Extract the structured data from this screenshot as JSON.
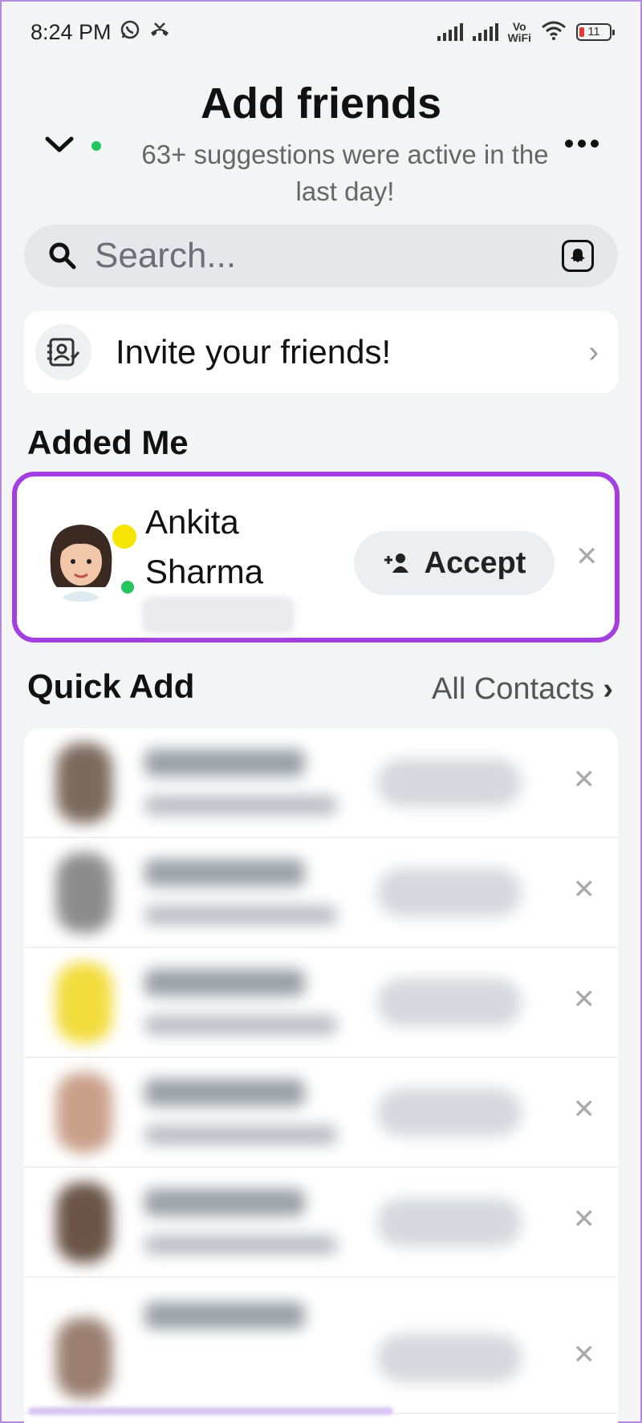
{
  "status_bar": {
    "time": "8:24 PM",
    "vowifi_top": "Vo",
    "vowifi_bottom": "WiFi",
    "battery": "11"
  },
  "header": {
    "title": "Add friends",
    "subtitle": "63+ suggestions were active in the last day!"
  },
  "search": {
    "placeholder": "Search..."
  },
  "invite": {
    "label": "Invite your friends!"
  },
  "added_me": {
    "section_title": "Added Me",
    "requests": [
      {
        "name_line1": "Ankita",
        "name_line2": "Sharma",
        "accept_label": "Accept"
      }
    ]
  },
  "quick_add": {
    "section_title": "Quick Add",
    "all_contacts_label": "All Contacts",
    "rows": [
      {
        "avatar_color": "#7b6a5e"
      },
      {
        "avatar_color": "#8c8c8c"
      },
      {
        "avatar_color": "#f2dc3c"
      },
      {
        "avatar_color": "#c9a08a"
      },
      {
        "avatar_color": "#6a5447"
      },
      {
        "avatar_color": "#9a7f70"
      }
    ]
  },
  "colors": {
    "highlight": "#a33ee0",
    "online": "#22c55e",
    "story": "#f5e500"
  }
}
